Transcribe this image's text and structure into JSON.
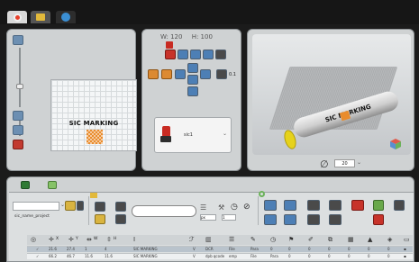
{
  "top_tabs": [
    {
      "label": "",
      "icon": "target-icon",
      "color": "#e8402a"
    },
    {
      "label": "",
      "icon": "picture-icon",
      "color": "#e2b93b"
    },
    {
      "label": "",
      "icon": "globe-icon",
      "color": "#3b8fd4"
    }
  ],
  "design": {
    "card_title": "SIC MARKING"
  },
  "settings": {
    "width_label": "W: 120",
    "height_label": "H: 100",
    "step_value": "0.1",
    "tool_name": "sic1",
    "tool_icon": "marking-head-icon"
  },
  "preview": {
    "roll_text": "SIC MARKING",
    "zoom_value": "20"
  },
  "project": {
    "name": "sic_name_project"
  },
  "toolbar": {
    "units_value": "px",
    "size_value": "1"
  },
  "table": {
    "headers": [
      {
        "icon": "target-icon",
        "label": ""
      },
      {
        "icon": "move-x-icon",
        "label": "X"
      },
      {
        "icon": "move-y-icon",
        "label": "Y"
      },
      {
        "icon": "width-icon",
        "label": "W"
      },
      {
        "icon": "height-icon",
        "label": "H"
      },
      {
        "icon": "text-icon",
        "label": ""
      },
      {
        "icon": "font-icon",
        "label": ""
      },
      {
        "icon": "barcode-icon",
        "label": ""
      },
      {
        "icon": "align-icon",
        "label": ""
      },
      {
        "icon": "pen-icon",
        "label": ""
      },
      {
        "icon": "clock-icon",
        "label": ""
      },
      {
        "icon": "flag-icon",
        "label": ""
      },
      {
        "icon": "paint-icon",
        "label": ""
      },
      {
        "icon": "copy-icon",
        "label": ""
      },
      {
        "icon": "grid-icon",
        "label": ""
      },
      {
        "icon": "triangle-icon",
        "label": ""
      },
      {
        "icon": "layers-icon",
        "label": ""
      },
      {
        "icon": "page-icon",
        "label": ""
      }
    ],
    "rows": [
      {
        "cells": [
          "✓",
          "21.6",
          "27.4",
          "1",
          "4",
          "SIC MARKING",
          "V",
          "DCR",
          "File",
          "Para",
          "0",
          "0",
          "0",
          "0",
          "0",
          "0",
          "0",
          "▪"
        ]
      },
      {
        "cells": [
          "✓",
          "66.2",
          "46.7",
          "11.6",
          "11.6",
          "SIC MARKING",
          "V",
          "dpb qcode",
          "emp",
          "File",
          "Para",
          "0",
          "0",
          "0",
          "0",
          "0",
          "0",
          "▪"
        ]
      }
    ]
  }
}
